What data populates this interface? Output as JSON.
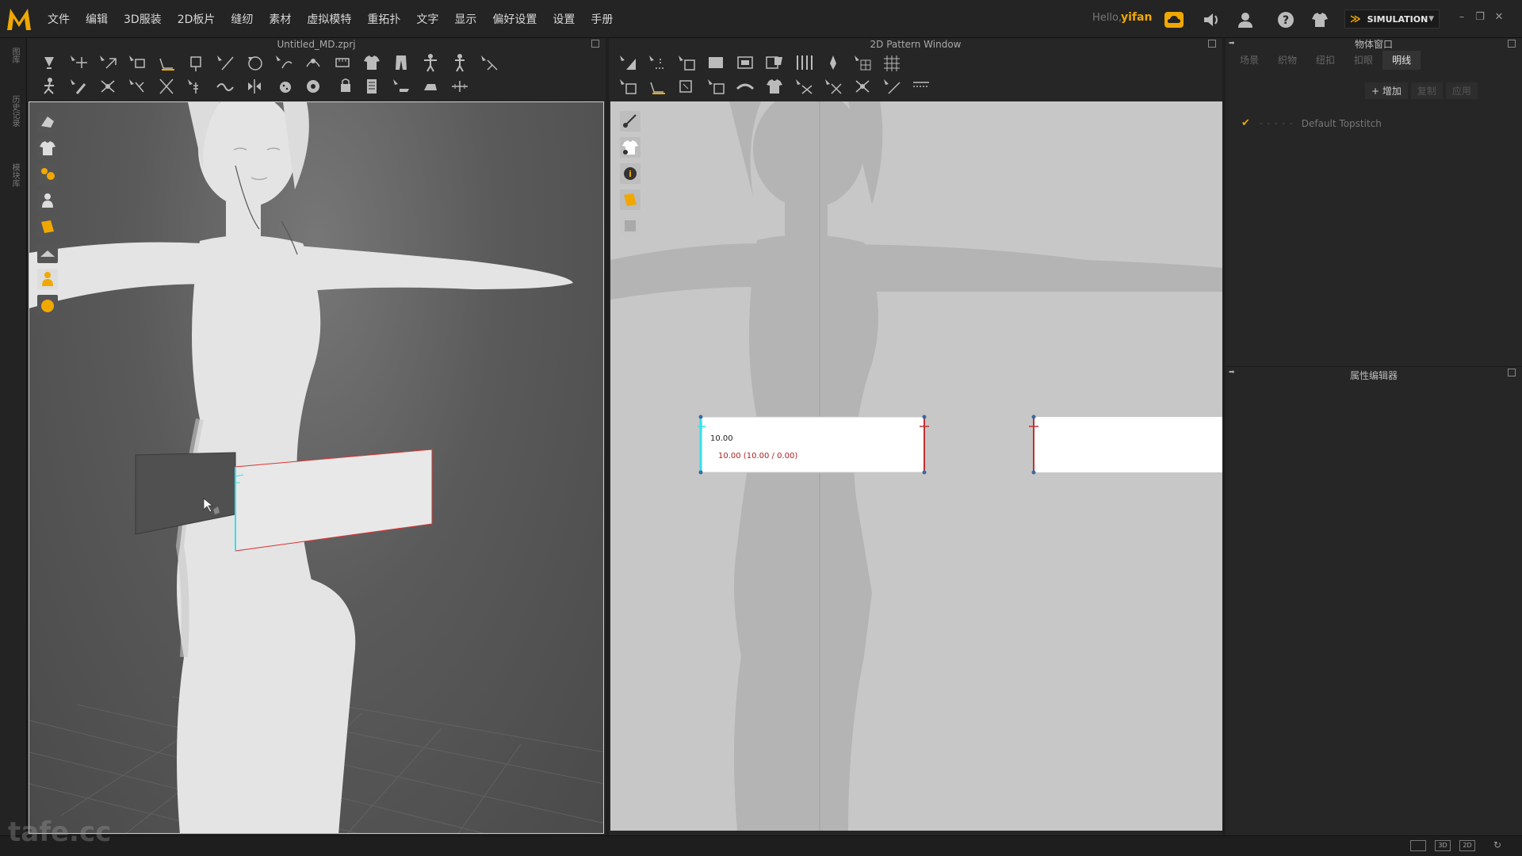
{
  "app": {
    "logo_letter": "M",
    "accent": "#f0a800"
  },
  "menu": [
    "文件",
    "编辑",
    "3D服装",
    "2D板片",
    "缝纫",
    "素材",
    "虚拟模特",
    "重拓扑",
    "文字",
    "显示",
    "偏好设置",
    "设置",
    "手册"
  ],
  "account": {
    "hello": "Hello,",
    "user": "yifan"
  },
  "mode": {
    "label": "SIMULATION"
  },
  "left_strip": {
    "tabs": [
      "图库",
      "历史记录",
      "模块库"
    ]
  },
  "panel_3d": {
    "title": "Untitled_MD.zprj"
  },
  "panel_2d": {
    "title": "2D Pattern Window",
    "dimension_main": "10.00",
    "dimension_sub": "10.00 (10.00 / 0.00)"
  },
  "object_window": {
    "title": "物体窗口",
    "tabs": [
      "场景",
      "织物",
      "纽扣",
      "扣眼",
      "明线"
    ],
    "active_tab": "明线",
    "actions": {
      "add": "+ 增加",
      "copy": "复制",
      "apply": "应用"
    },
    "topstitch": {
      "dash": "- - - - -",
      "name": "Default Topstitch"
    }
  },
  "property_editor": {
    "title": "属性编辑器"
  },
  "bottom": {
    "views": [
      "",
      "3D",
      "2D"
    ]
  },
  "watermark": "tafe.cc"
}
